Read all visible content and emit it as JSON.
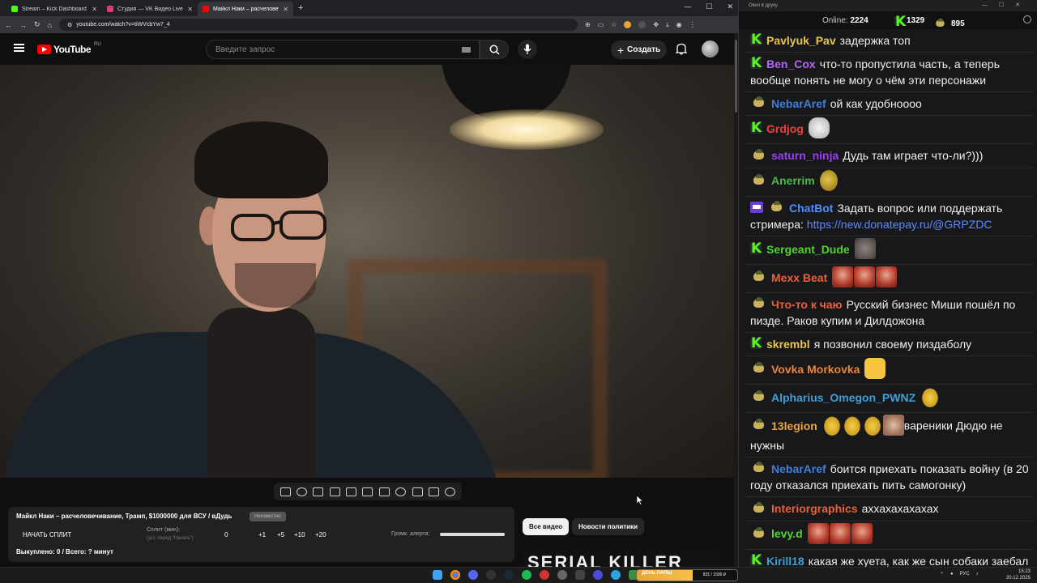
{
  "browser": {
    "tabs": [
      {
        "title": "Stream – Kick Dashboard",
        "color": "#53fc18"
      },
      {
        "title": "Студия — VK Видео Live",
        "color": "#e03a7a"
      },
      {
        "title": "Майкл Наки – расчеловеч...",
        "color": "#ff0000"
      }
    ],
    "url": "youtube.com/watch?v=tiWVcbYw7_4"
  },
  "youtube": {
    "logo_text": "YouTube",
    "logo_region": "RU",
    "search_placeholder": "Введите запрос",
    "create_label": "Создать"
  },
  "panel": {
    "video_title": "Майкл Наки – расчеловечивание, Трамп, $1000000 для ВСУ / вДудь",
    "badge": "Неизвестно",
    "start_split": "НАЧАТЬ СПЛИТ",
    "split_label": "Сплит (мин):",
    "split_hint": "(уст. перед \"Начать\")",
    "split_value": "0",
    "increments": [
      "+1",
      "+5",
      "+10",
      "+20"
    ],
    "volume_label": "Громк. алерта:",
    "volume_level": 1.0,
    "bought": "Выкуплено: 0 / Всего: ? минут"
  },
  "chips": {
    "all": "Все видео",
    "politics": "Новости политики"
  },
  "related_thumb_text": "SERIAL KILLER",
  "chat": {
    "window_title": "Окно в друку",
    "online_label": "Online:",
    "online_count": "2224",
    "kick_count": "1329",
    "guard_count": "895",
    "messages": [
      {
        "icon": "kick",
        "nick": "Pavlyuk_Pav",
        "color": "#e9c74a",
        "text": "задержка топ"
      },
      {
        "icon": "kick",
        "nick": "Ben_Cox",
        "color": "#b267f5",
        "text": "что-то пропустила часть, а теперь вообще понять не могу о чём эти персонажи"
      },
      {
        "icon": "guard",
        "nick": "NebarAref",
        "color": "#3f7fd8",
        "text": "ой как удобноооо"
      },
      {
        "icon": "kick",
        "nick": "Grdjog",
        "color": "#f0413a",
        "text": "",
        "emotes": [
          "pale"
        ]
      },
      {
        "icon": "guard",
        "nick": "saturn_ninja",
        "color": "#9b3ff5",
        "text": "Дудь там играет что-ли?)))"
      },
      {
        "icon": "guard",
        "nick": "Anerrim",
        "color": "#4fb84a",
        "text": "",
        "emotes": [
          "potato"
        ]
      },
      {
        "icon": "bot",
        "nick": "ChatBot",
        "color": "#4f8cff",
        "text": "Задать вопрос или поддержать стримера: ",
        "link": "https://new.donatepay.ru/@GRPZDC"
      },
      {
        "icon": "kick",
        "nick": "Sergeant_Dude",
        "color": "#4fd32f",
        "text": "",
        "emotes": [
          "rat"
        ]
      },
      {
        "icon": "guard",
        "nick": "Mexx Beat",
        "color": "#e8613a",
        "text": "",
        "emotes": [
          "face",
          "face",
          "face"
        ]
      },
      {
        "icon": "guard",
        "nick": "Что-то к чаю",
        "color": "#e8613a",
        "text": "Русский бизнес Миши пошёл по пизде. Раков купим и Дилдожона"
      },
      {
        "icon": "kick",
        "nick": "skrembl",
        "color": "#e9c74a",
        "text": "я позвонил своему пиздаболу"
      },
      {
        "icon": "guard",
        "nick": "Vovka Morkovka",
        "color": "#e8863a",
        "text": "",
        "emotes": [
          "smile"
        ]
      },
      {
        "icon": "guard",
        "nick": "Alpharius_Omegon_PWNZ",
        "color": "#3f9fd8",
        "text": "",
        "emotes": [
          "dump"
        ]
      },
      {
        "icon": "guard",
        "nick": "13legion",
        "color": "#e8a53a",
        "text": "вареники Дюдю не нужны",
        "emotes": [
          "dump",
          "dump",
          "dump",
          "kitten"
        ]
      },
      {
        "icon": "guard",
        "nick": "NebarAref",
        "color": "#3f7fd8",
        "text": "боится приехать показать войну (в 20 году отказался приехать пить самогонку)"
      },
      {
        "icon": "guard",
        "nick": "Interiorgraphics",
        "color": "#e8613a",
        "text": "аххахахахахах"
      },
      {
        "icon": "guard",
        "nick": "levy.d",
        "color": "#4fd32f",
        "text": "",
        "emotes": [
          "face",
          "face",
          "face"
        ]
      },
      {
        "icon": "kick",
        "nick": "Kirill18",
        "color": "#3f9fd8",
        "text": "какая же хуета, как же сын собаки заебал"
      }
    ]
  },
  "taskbar": {
    "goal_label": "ДЕНЬ ПАПЫ",
    "goal_amount": "831 / 1500 ₽",
    "goal_fraction": 0.554,
    "lang": "РУС",
    "time": "15:23",
    "date": "20.12.2025"
  }
}
